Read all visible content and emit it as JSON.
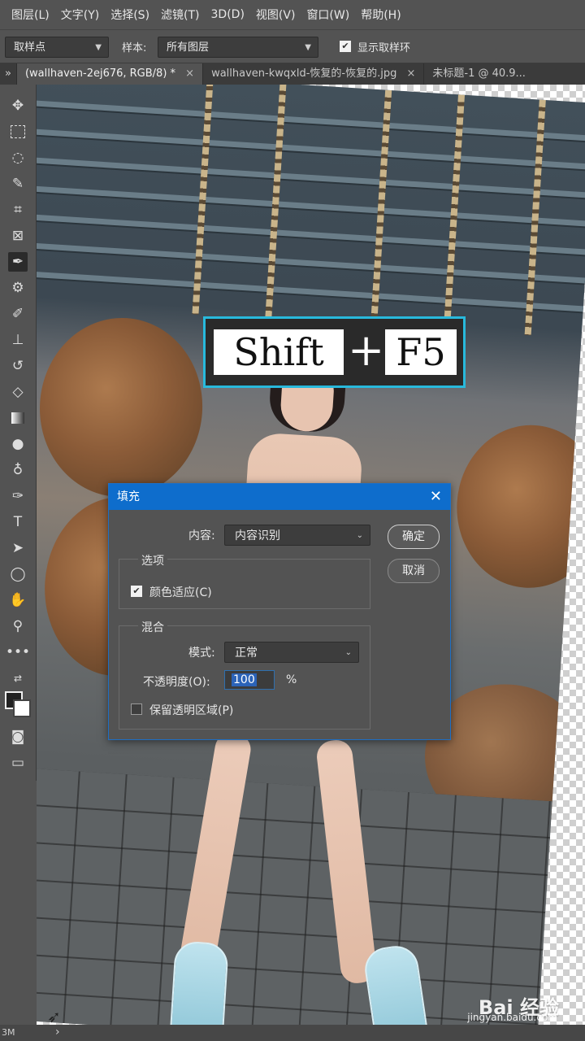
{
  "menu": [
    "图层(L)",
    "文字(Y)",
    "选择(S)",
    "滤镜(T)",
    "3D(D)",
    "视图(V)",
    "窗口(W)",
    "帮助(H)"
  ],
  "options": {
    "sample_point": "取样点",
    "sample_label": "样本:",
    "sample_value": "所有图层",
    "show_ring_label": "显示取样环",
    "show_ring_checked": true
  },
  "tabs": [
    {
      "label": "(wallhaven-2ej676, RGB/8) *",
      "close": "×"
    },
    {
      "label": "wallhaven-kwqxld-恢复的-恢复的.jpg",
      "close": "×"
    },
    {
      "label": "未标题-1 @ 40.9...",
      "close": ""
    }
  ],
  "tabs_collapse": "»",
  "tools": [
    "move-icon",
    "marquee-icon",
    "lasso-icon",
    "magic-wand-icon",
    "crop-icon",
    "frame-icon",
    "eyedropper-icon",
    "healing-brush-icon",
    "brush-icon",
    "clone-stamp-icon",
    "history-brush-icon",
    "eraser-icon",
    "gradient-icon",
    "blur-icon",
    "dodge-icon",
    "pen-icon",
    "type-icon",
    "path-select-icon",
    "ellipse-icon",
    "hand-icon",
    "zoom-icon",
    "more-icon"
  ],
  "shortcut": {
    "key1": "Shift",
    "plus": "+",
    "key2": "F5"
  },
  "dialog": {
    "title": "填充",
    "close": "✕",
    "content_label": "内容:",
    "content_value": "内容识别",
    "ok": "确定",
    "cancel": "取消",
    "options_legend": "选项",
    "color_adapt": "颜色适应(C)",
    "color_adapt_checked": true,
    "blend_legend": "混合",
    "mode_label": "模式:",
    "mode_value": "正常",
    "opacity_label": "不透明度(O):",
    "opacity_value": "100",
    "opacity_unit": "%",
    "preserve_label": "保留透明区域(P)",
    "preserve_checked": false
  },
  "status": {
    "left": "3M",
    "arrow": "›"
  },
  "watermark": {
    "main": "Bai 经验",
    "sub": "jingyan.baidu.com"
  }
}
